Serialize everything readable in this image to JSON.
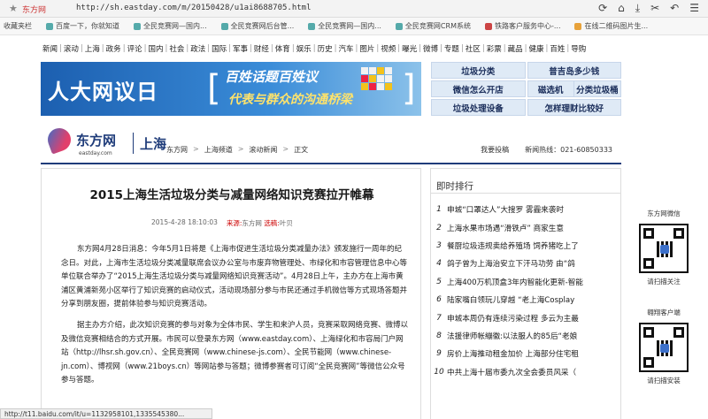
{
  "browser": {
    "site_label": "东方网",
    "url": "http://sh.eastday.com/m/20150428/u1ai8688705.html"
  },
  "bookmarks": [
    {
      "label": "收藏夹栏",
      "icon": "star-icon"
    },
    {
      "label": "百度一下，你就知道",
      "icon": "baidu-icon"
    },
    {
      "label": "全民竞赛网—国内...",
      "icon": "page-icon"
    },
    {
      "label": "全民竞赛网后台管...",
      "icon": "page-icon"
    },
    {
      "label": "全民竞赛网—国内...",
      "icon": "page-icon"
    },
    {
      "label": "全民竞赛网CRM系统",
      "icon": "page-icon"
    },
    {
      "label": "铁路客户服务中心-...",
      "icon": "train-icon"
    },
    {
      "label": "在线二维码图片生...",
      "icon": "qr-icon"
    }
  ],
  "nav": [
    "新闻",
    "滚动",
    "上海",
    "政务",
    "评论",
    "国内",
    "社会",
    "政法",
    "国际",
    "军事",
    "财经",
    "体育",
    "娱乐",
    "历史",
    "汽车",
    "图片",
    "视频",
    "曝光",
    "微博",
    "专题",
    "社区",
    "彩票",
    "藏品",
    "健康",
    "百姓",
    "导购"
  ],
  "banner": {
    "brand": "人大网议日",
    "slogan_line1": "百姓话题百姓议",
    "slogan_line2": "代表与群众的沟通桥梁"
  },
  "ad_grid": [
    "垃圾分类",
    "普吉岛多少钱",
    "微信怎么开店",
    "磁选机",
    "分类垃圾桶",
    "垃圾处理设备",
    "怎样理财比较好"
  ],
  "brand": {
    "name": "东方网",
    "domain": "eastday.com",
    "city": "上海",
    "crumbs": [
      "东方网",
      "上海频道",
      "滚动新闻",
      "正文"
    ],
    "submit": "我要投稿",
    "hotline": "新闻热线：021-60850333"
  },
  "article": {
    "title": "2015上海生活垃圾分类与减量网络知识竞赛拉开帷幕",
    "date": "2015-4-28 18:10:03",
    "source_label": "来源:",
    "source": "东方网",
    "editor_label": "选稿:",
    "editor": "叶贝",
    "paragraph1": "东方网4月28日消息：今年5月1日将是《上海市促进生活垃圾分类减量办法》颁发施行一周年的纪念日。对此，上海市生活垃圾分类减量联席会议办公室与市废弃物管理处、市绿化和市容管理信息中心等单位联合举办了“2015上海生活垃圾分类与减量网络知识竞赛活动”。4月28日上午，主办方在上海市黄浦区黄浦新苑小区举行了知识竞赛的启动仪式，活动现场部分参与市民还通过手机微信等方式现场答题并分享到朋友圈，提前体验参与知识竞赛活动。",
    "paragraph2": "据主办方介绍，此次知识竞赛的参与对象为全体市民、学生和来沪人员，竞赛采取网络竞赛、微博以及微信竞赛相结合的方式开展。市民可以登录东方网（www.eastday.com）、上海绿化和市容局门户网站（http://lhsr.sh.gov.cn）、全民竞赛网（www.chinese-js.com）、全民节能网（www.chinese-jn.com）、博视网（www.21boys.cn）等网站参与答题；微博参赛者可订阅“全民竞赛网”等微信公众号参与答题。"
  },
  "hot": {
    "heading": "即时排行",
    "items": [
      "申城“口罩达人”大搜罗 雾霾来袭时",
      "上海水果市场遇“滑铁卢” 商家生意",
      "餐厨垃圾违规卖给养殖场 饲养猪吃上了",
      "鸽子曾为上海治安立下汗马功劳 由“鸽",
      "上海400万机顶盒3年内智能化更新-智能",
      "陆家嘴白领玩儿穿越 “老上海Cosplay",
      "申城本周仍有连续污染过程 多云为主最",
      "法援律师帐繃徽:以法服人的85后“老娘",
      "房价上海推动租金加价 上海部分住宅租",
      "中共上海十届市委九次全会委员风采（"
    ]
  },
  "side": [
    {
      "caption": "东方网微信",
      "sub": "请扫描关注"
    },
    {
      "caption": "翱翔客户端",
      "sub": "请扫描安装"
    }
  ],
  "status_text": "http://t11.baidu.com/it/u=1132958101,1335545380..."
}
